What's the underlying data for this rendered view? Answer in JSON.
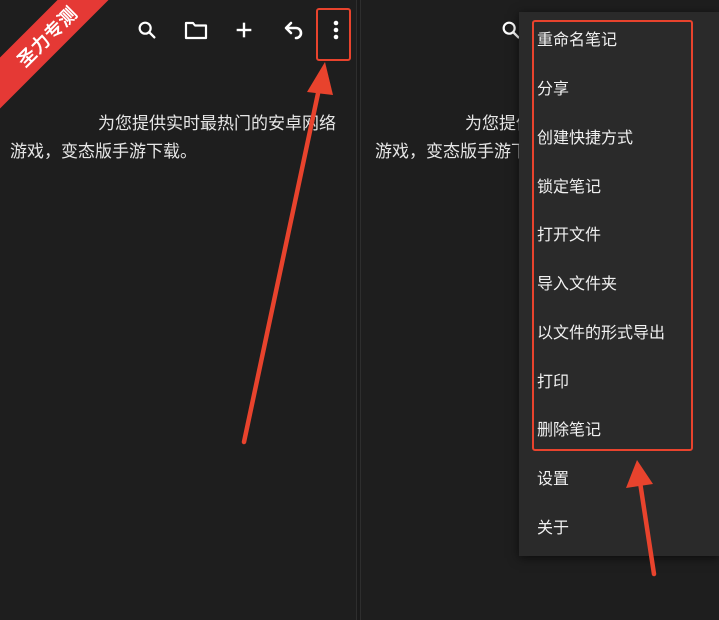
{
  "badge": {
    "text": "圣力专测"
  },
  "note": {
    "line1": "为您提供实时最热门的安卓网络",
    "line2": "游戏，变态版手游下载。",
    "line1_clipped": "为您提供",
    "line2_clipped": "游戏，变态版手游下"
  },
  "toolbar": {
    "icons": [
      "search-icon",
      "folder-icon",
      "add-icon",
      "undo-icon",
      "more-vert-icon"
    ]
  },
  "menu": {
    "items": [
      "重命名笔记",
      "分享",
      "创建快捷方式",
      "锁定笔记",
      "打开文件",
      "导入文件夹",
      "以文件的形式导出",
      "打印",
      "删除笔记",
      "设置",
      "关于"
    ]
  },
  "colors": {
    "background": "#1e1e1e",
    "menu_background": "#2a2a2a",
    "annotation": "#e8432d",
    "badge": "#e53935",
    "text": "#e6e6e6"
  }
}
